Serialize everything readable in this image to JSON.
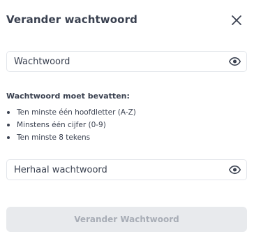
{
  "dialog": {
    "title": "Verander wachtwoord",
    "close_icon": "close-icon"
  },
  "password_field": {
    "placeholder": "Wachtwoord",
    "value": "",
    "toggle_icon": "eye-icon"
  },
  "requirements": {
    "title": "Wachtwoord moet bevatten:",
    "items": [
      "Ten minste één hoofdletter (A-Z)",
      "Minstens één cijfer (0-9)",
      "Ten minste 8 tekens"
    ]
  },
  "repeat_field": {
    "placeholder": "Herhaal wachtwoord",
    "value": "",
    "toggle_icon": "eye-icon"
  },
  "submit": {
    "label": "Verander Wachtwoord"
  },
  "colors": {
    "text": "#3a4150",
    "border": "#e3e6eb",
    "button_bg": "#e8eaed",
    "button_text": "#a8adb6"
  }
}
